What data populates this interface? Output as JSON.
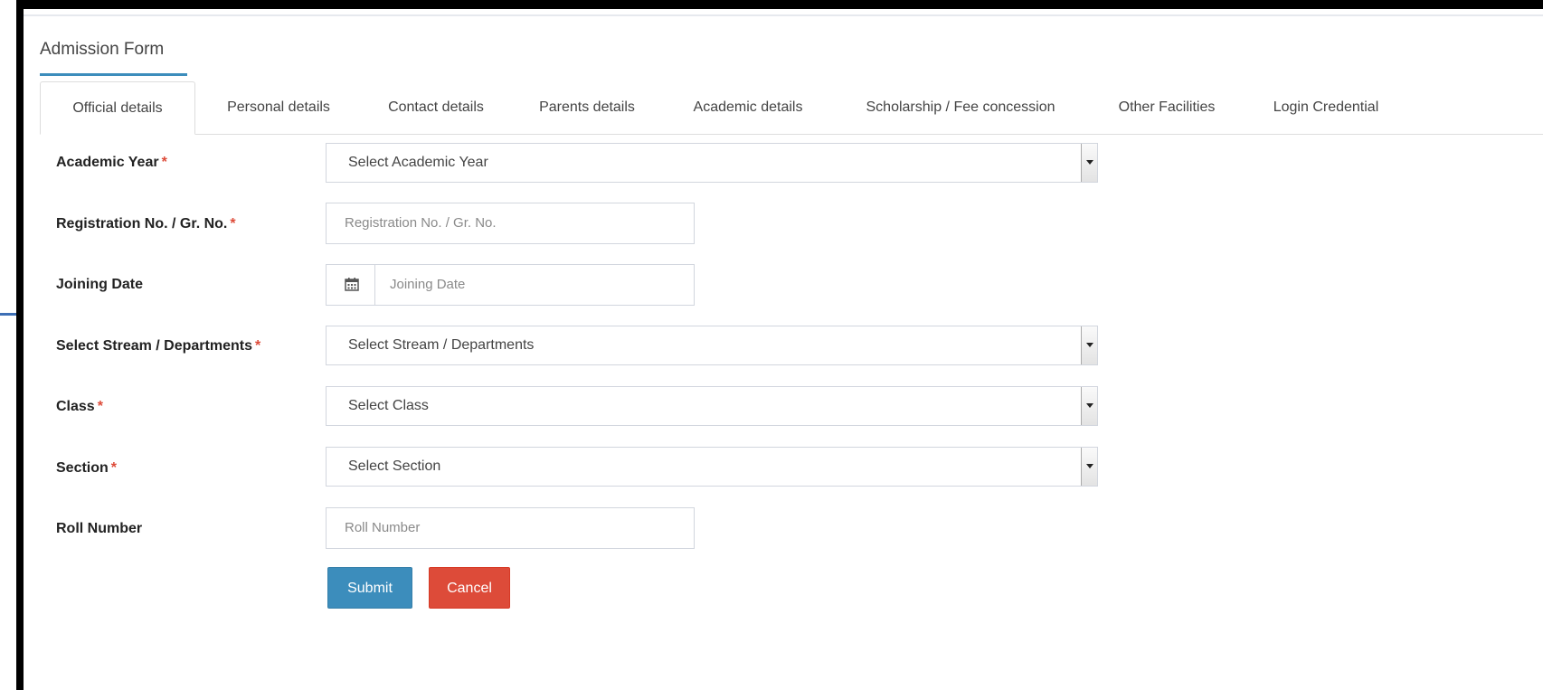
{
  "form": {
    "title": "Admission Form"
  },
  "tabs": [
    {
      "label": "Official details",
      "active": true
    },
    {
      "label": "Personal details"
    },
    {
      "label": "Contact details"
    },
    {
      "label": "Parents details"
    },
    {
      "label": "Academic details"
    },
    {
      "label": "Scholarship / Fee concession"
    },
    {
      "label": "Other Facilities"
    },
    {
      "label": "Login Credential"
    }
  ],
  "fields": {
    "academic_year": {
      "label": "Academic Year",
      "required": "*",
      "value": "Select Academic Year"
    },
    "registration_no": {
      "label": "Registration No. / Gr. No.",
      "required": "*",
      "placeholder": "Registration No. / Gr. No."
    },
    "joining_date": {
      "label": "Joining Date",
      "placeholder": "Joining Date",
      "icon": "calendar-icon"
    },
    "stream": {
      "label": "Select Stream / Departments",
      "required": "*",
      "value": "Select Stream / Departments"
    },
    "class": {
      "label": "Class",
      "required": "*",
      "value": "Select Class"
    },
    "section": {
      "label": "Section",
      "required": "*",
      "value": "Select Section"
    },
    "roll_number": {
      "label": "Roll Number",
      "placeholder": "Roll Number"
    }
  },
  "buttons": {
    "submit": "Submit",
    "cancel": "Cancel"
  },
  "colors": {
    "primary": "#3c8dbc",
    "danger": "#dd4b39",
    "required": "#dd4b39"
  }
}
